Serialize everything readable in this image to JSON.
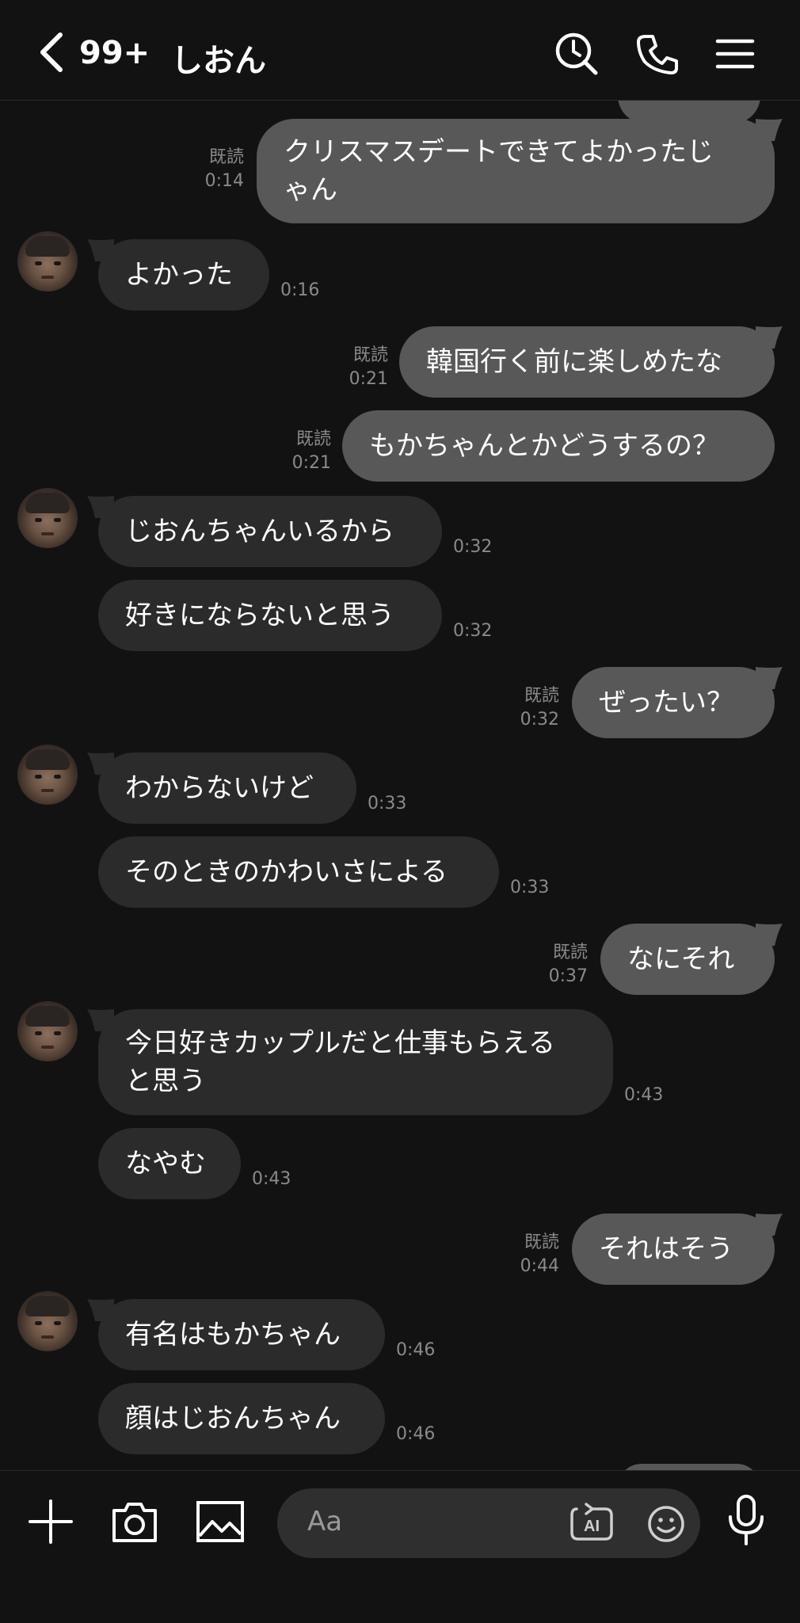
{
  "header": {
    "unread_count": "99+",
    "chat_name": "しおん"
  },
  "messages": [
    {
      "dir": "out",
      "text": "クリスマスデートできてよかったじ\nゃん",
      "read": "既読",
      "time": "0:14"
    },
    {
      "dir": "in",
      "text": "よかった",
      "time": "0:16"
    },
    {
      "dir": "out",
      "text": "韓国行く前に楽しめたな",
      "read": "既読",
      "time": "0:21"
    },
    {
      "dir": "out",
      "text": "もかちゃんとかどうするの？",
      "read": "既読",
      "time": "0:21"
    },
    {
      "dir": "in",
      "text": "じおんちゃんいるから",
      "time": "0:32"
    },
    {
      "dir": "in",
      "text": "好きにならないと思う",
      "time": "0:32"
    },
    {
      "dir": "out",
      "text": "ぜったい？",
      "read": "既読",
      "time": "0:32"
    },
    {
      "dir": "in",
      "text": "わからないけど",
      "time": "0:33"
    },
    {
      "dir": "in",
      "text": "そのときのかわいさによる",
      "time": "0:33"
    },
    {
      "dir": "out",
      "text": "なにそれ",
      "read": "既読",
      "time": "0:37"
    },
    {
      "dir": "in",
      "text": "今日好きカップルだと仕事もらえる\nと思う",
      "time": "0:43"
    },
    {
      "dir": "in",
      "text": "なやむ",
      "time": "0:43"
    },
    {
      "dir": "out",
      "text": "それはそう",
      "read": "既読",
      "time": "0:44"
    },
    {
      "dir": "in",
      "text": "有名はもかちゃん",
      "time": "0:46"
    },
    {
      "dir": "in",
      "text": "顔はじおんちゃん",
      "time": "0:46"
    }
  ],
  "composer": {
    "placeholder": "Aa",
    "ai_label": "AI"
  },
  "icons": {
    "back": "chevron-left-icon",
    "search": "search-clock-icon",
    "call": "phone-icon",
    "menu": "hamburger-menu-icon",
    "add": "plus-icon",
    "camera": "camera-icon",
    "image": "image-icon",
    "ai": "ai-icon",
    "emoji": "emoji-icon",
    "mic": "microphone-icon"
  },
  "colors": {
    "background": "#121212",
    "incoming_bubble": "#2b2b2b",
    "outgoing_bubble": "#585858",
    "meta_text": "#8a8a8a"
  }
}
